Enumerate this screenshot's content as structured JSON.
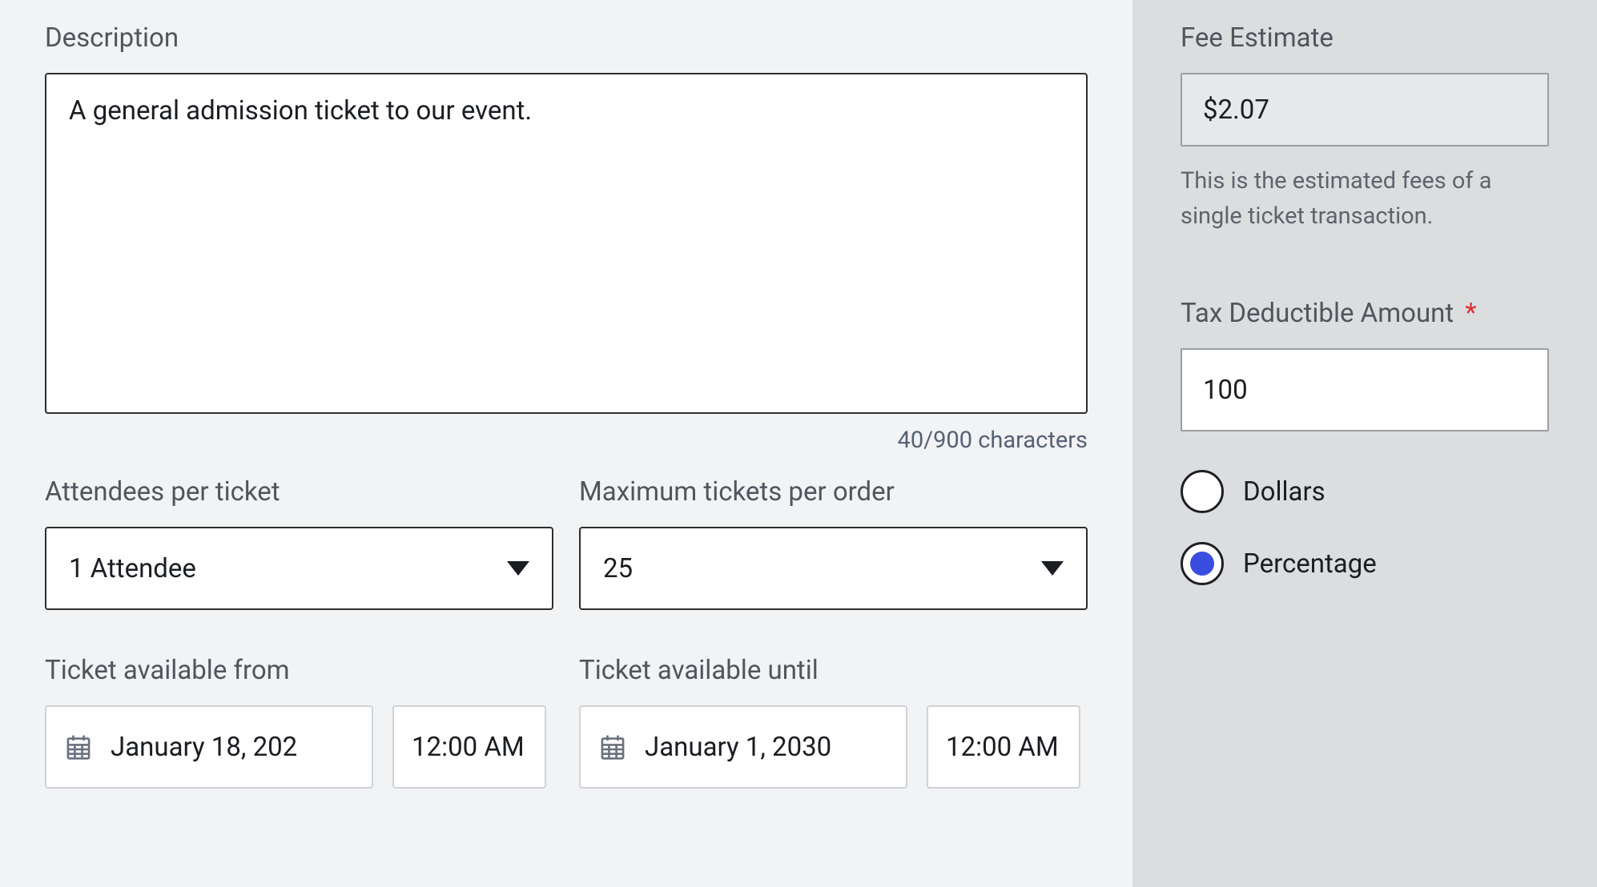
{
  "description": {
    "label": "Description",
    "value": "A general admission ticket to our event.",
    "char_count": "40/900 characters"
  },
  "attendees": {
    "label": "Attendees per ticket",
    "value": "1 Attendee"
  },
  "max_tickets": {
    "label": "Maximum tickets per order",
    "value": "25"
  },
  "available_from": {
    "label": "Ticket available from",
    "date": "January 18, 202",
    "time": "12:00 AM"
  },
  "available_until": {
    "label": "Ticket available until",
    "date": "January 1, 2030",
    "time": "12:00 AM"
  },
  "fee_estimate": {
    "label": "Fee Estimate",
    "value": "$2.07",
    "hint": "This is the estimated fees of a single ticket transaction."
  },
  "tax_deductible": {
    "label": "Tax Deductible Amount",
    "required_mark": "*",
    "value": "100",
    "options": {
      "dollars": "Dollars",
      "percentage": "Percentage"
    },
    "selected": "percentage"
  }
}
